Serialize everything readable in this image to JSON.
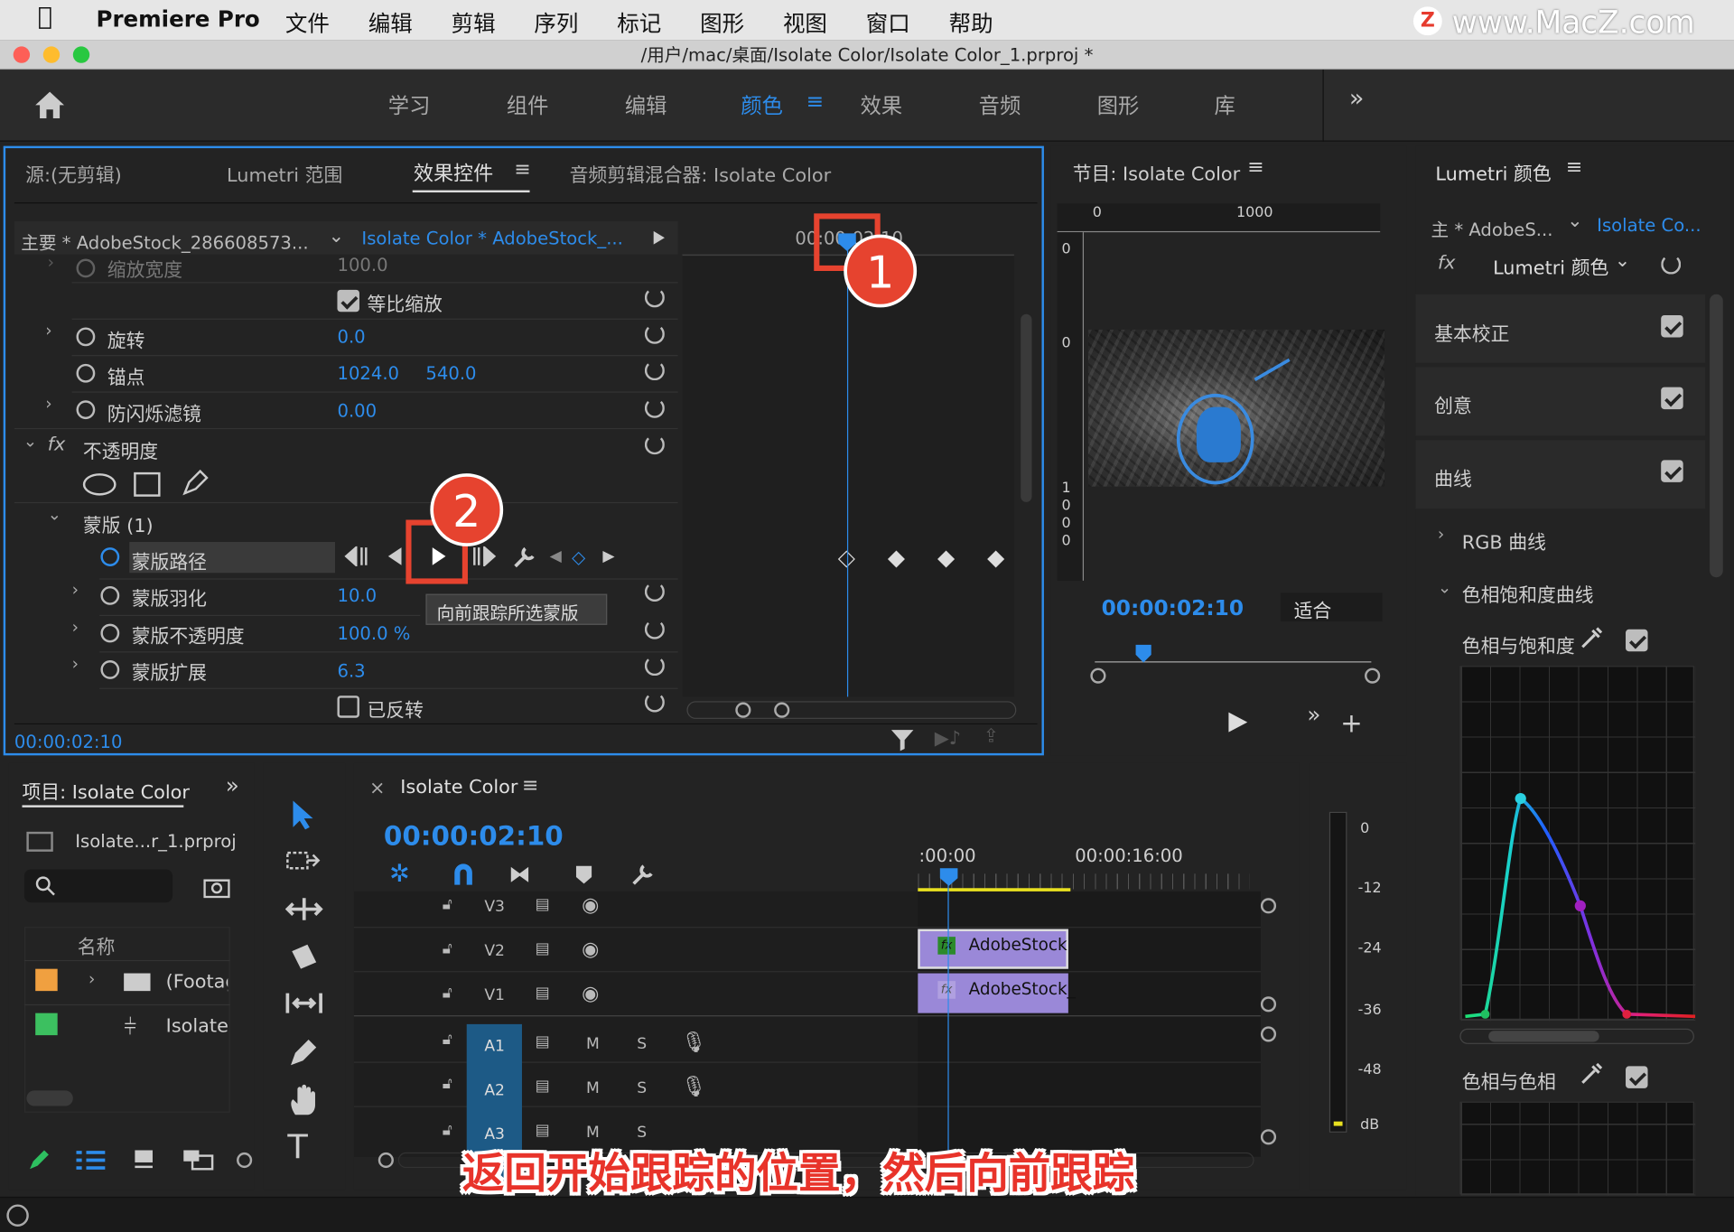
{
  "menubar": {
    "app": "Premiere Pro",
    "items": [
      "文件",
      "编辑",
      "剪辑",
      "序列",
      "标记",
      "图形",
      "视图",
      "窗口",
      "帮助"
    ],
    "watermark": "www.MacZ.com",
    "watermark_badge": "Z"
  },
  "window": {
    "title": "/用户/mac/桌面/Isolate Color/Isolate Color_1.prproj *"
  },
  "workspaces": {
    "items": [
      "学习",
      "组件",
      "编辑",
      "颜色",
      "效果",
      "音频",
      "图形",
      "库"
    ],
    "active": "颜色",
    "more": "»"
  },
  "source_panel": {
    "tabs": [
      "源:(无剪辑)",
      "Lumetri 范围",
      "效果控件",
      "音频剪辑混合器: Isolate Color"
    ],
    "active_tab": "效果控件",
    "clip_master": "主要 * AdobeStock_286608573...",
    "clip_seq": "Isolate Color * AdobeStock_...",
    "ruler_time": "00:00:02:10",
    "rows": {
      "scale_width_label": "缩放宽度",
      "scale_width_value": "100.0",
      "uniform_scale": "等比缩放",
      "rotation_label": "旋转",
      "rotation_value": "0.0",
      "anchor_label": "锚点",
      "anchor_x": "1024.0",
      "anchor_y": "540.0",
      "flicker_label": "防闪烁滤镜",
      "flicker_value": "0.00",
      "opacity_label": "不透明度",
      "mask_group": "蒙版 (1)",
      "mask_path": "蒙版路径",
      "feather_label": "蒙版羽化",
      "feather_value": "10.0",
      "mask_opacity_label": "蒙版不透明度",
      "mask_opacity_value": "100.0 %",
      "expansion_label": "蒙版扩展",
      "expansion_value": "6.3",
      "inverted_label": "已反转"
    },
    "fx_symbol": "fx",
    "tooltip": "向前跟踪所选蒙版",
    "timecode": "00:00:02:10"
  },
  "program": {
    "title": "节目: Isolate Color",
    "ruler_0": "0",
    "ruler_1000": "1000",
    "side_0a": "0",
    "side_0b": "0",
    "side_1000": "1000",
    "timecode": "00:00:02:10",
    "fit": "适合"
  },
  "lumetri": {
    "title": "Lumetri 颜色",
    "master": "主 * AdobeS...",
    "seq": "Isolate Co...",
    "fx": "fx",
    "effect": "Lumetri 颜色",
    "sections": [
      "基本校正",
      "创意",
      "曲线"
    ],
    "rgb_curves": "RGB 曲线",
    "hsl_curves": "色相饱和度曲线",
    "hue_sat": "色相与饱和度",
    "hue_hue": "色相与色相"
  },
  "project": {
    "title": "项目: Isolate Color",
    "file": "Isolate...r_1.prproj",
    "col_name": "名称",
    "items": [
      "(Footag",
      "Isolate"
    ],
    "colors": [
      "#f0a040",
      "#3cc060"
    ]
  },
  "timeline": {
    "title": "Isolate Color",
    "timecode": "00:00:02:10",
    "ruler": [
      ":00:00",
      "00:00:16:00"
    ],
    "tracks": [
      "V3",
      "V2",
      "V1",
      "A1",
      "A2",
      "A3"
    ],
    "clip_v2": "AdobeStock",
    "clip_v1": "AdobeStock_",
    "m": "M",
    "s": "S"
  },
  "meter": {
    "labels": [
      "0",
      "-12",
      "-24",
      "-36",
      "-48",
      "dB"
    ]
  },
  "annotations": {
    "one": "1",
    "two": "2",
    "caption": "返回开始跟踪的位置，然后向前跟踪"
  }
}
